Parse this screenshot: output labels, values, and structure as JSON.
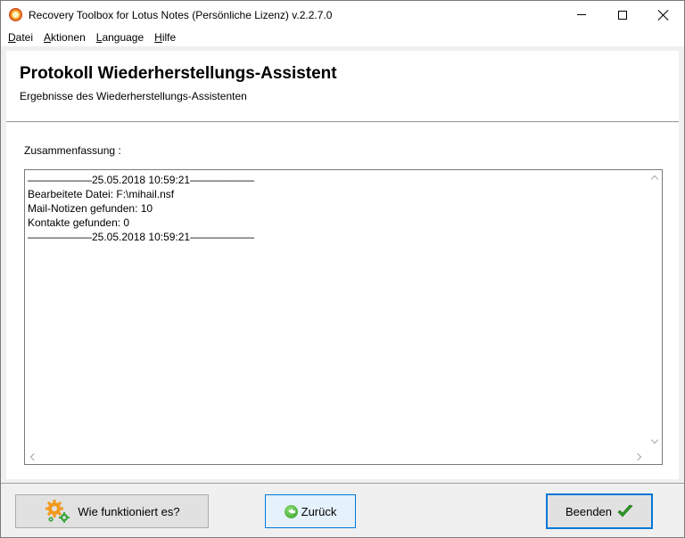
{
  "window": {
    "title": "Recovery Toolbox for Lotus Notes (Persönliche Lizenz) v.2.2.7.0"
  },
  "menu": {
    "items": [
      {
        "first": "D",
        "rest": "atei"
      },
      {
        "first": "A",
        "rest": "ktionen"
      },
      {
        "first": "L",
        "rest": "anguage"
      },
      {
        "first": "H",
        "rest": "ilfe"
      }
    ]
  },
  "header": {
    "title": "Protokoll Wiederherstellungs-Assistent",
    "subtitle": "Ergebnisse des Wiederherstellungs-Assistenten"
  },
  "content": {
    "summary_label": "Zusammenfassung :",
    "log_lines": [
      "——————25.05.2018 10:59:21——————",
      "Bearbeitete Datei: F:\\mihail.nsf",
      "Mail-Notizen gefunden: 10",
      "Kontakte gefunden: 0",
      "——————25.05.2018 10:59:21——————"
    ]
  },
  "footer": {
    "help_label": "Wie funktioniert es?",
    "back_label": "Zurück",
    "finish_label": "Beenden"
  },
  "colors": {
    "accent": "#0078d7",
    "check_green": "#2e9a22",
    "gear_orange": "#f29a1d",
    "gear_green": "#3aa640"
  },
  "icons": {
    "app": "app-icon",
    "help": "gear-icon",
    "back": "back-arrow-icon",
    "finish": "check-icon"
  }
}
